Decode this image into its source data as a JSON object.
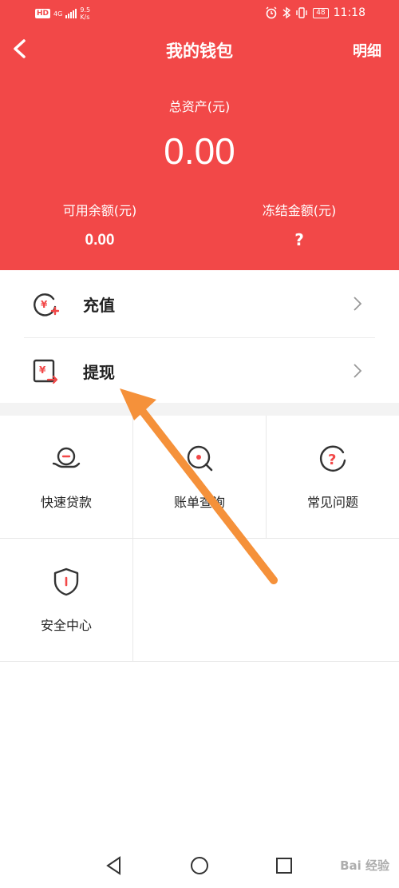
{
  "status_bar": {
    "hd": "HD",
    "network": "4G",
    "speed_value": "9.5",
    "speed_unit": "K/s",
    "battery": "48",
    "time": "11:18"
  },
  "header": {
    "title": "我的钱包",
    "detail_label": "明细",
    "total_label": "总资产(元)",
    "total_value": "0.00",
    "available_label": "可用余额(元)",
    "available_value": "0.00",
    "frozen_label": "冻结金额(元)",
    "frozen_value": "?"
  },
  "list": [
    {
      "label": "充值",
      "icon": "recharge-icon"
    },
    {
      "label": "提现",
      "icon": "withdraw-icon"
    }
  ],
  "grid": [
    {
      "label": "快速贷款",
      "icon": "quick-loan-icon"
    },
    {
      "label": "账单查询",
      "icon": "bill-query-icon"
    },
    {
      "label": "常见问题",
      "icon": "faq-icon"
    },
    {
      "label": "安全中心",
      "icon": "security-center-icon"
    }
  ],
  "watermark": "Bai 经验",
  "colors": {
    "brand_red": "#f24848",
    "icon_dark": "#333333",
    "arrow_orange": "#f5913a"
  }
}
